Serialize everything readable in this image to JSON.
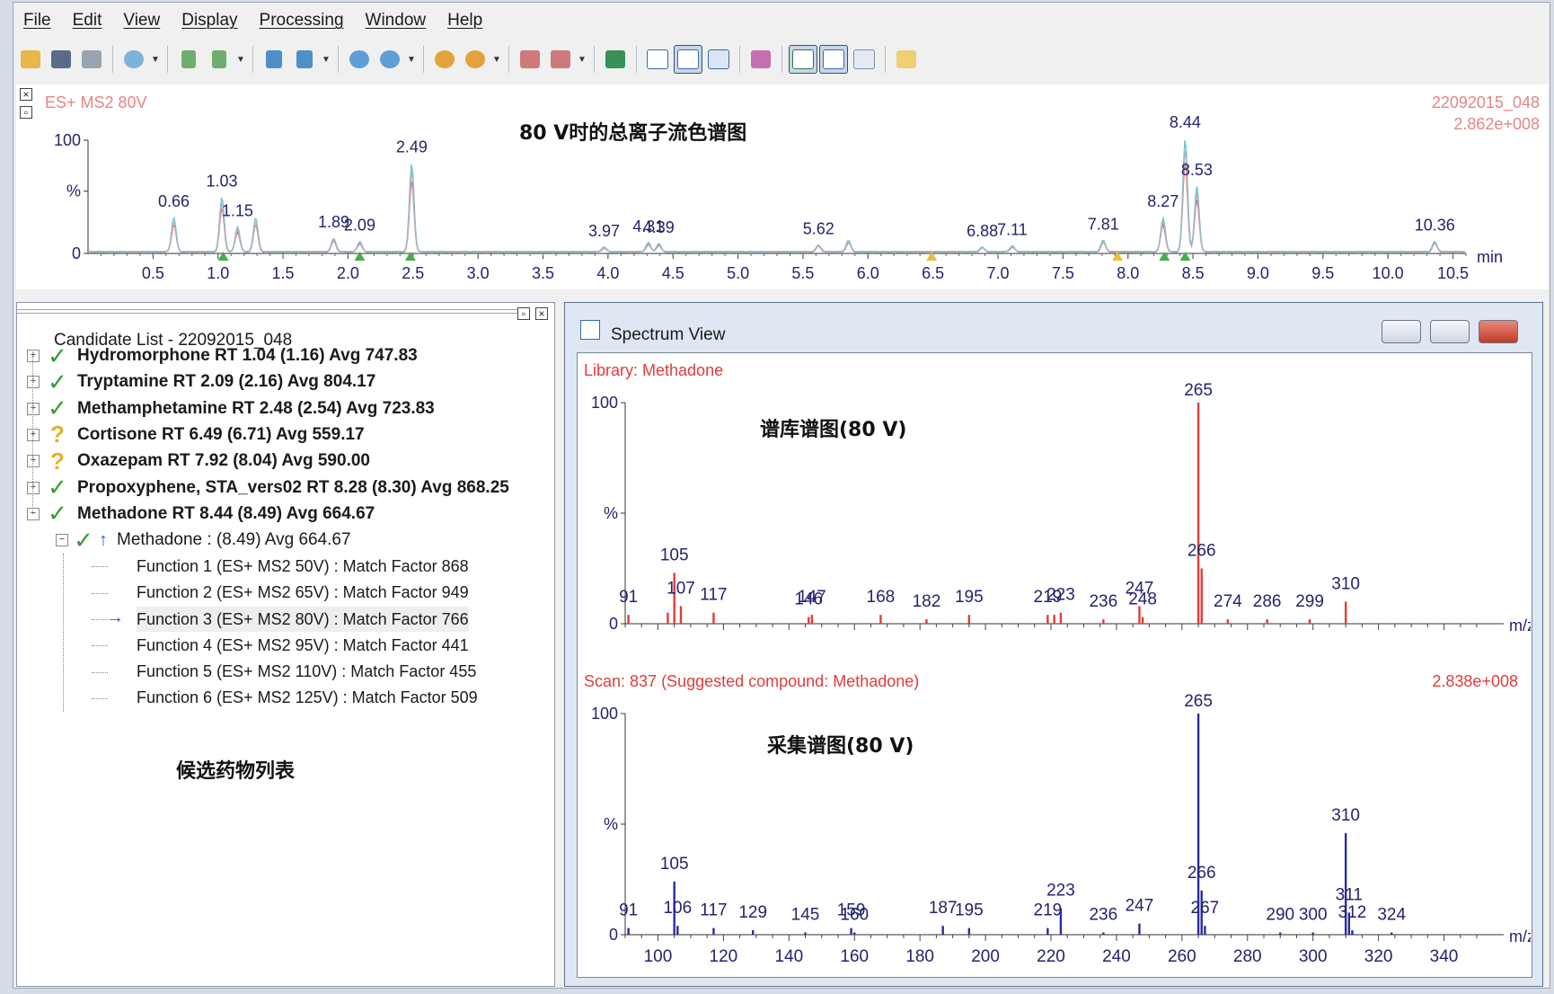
{
  "menu": [
    "File",
    "Edit",
    "View",
    "Display",
    "Processing",
    "Window",
    "Help"
  ],
  "toolbar": {
    "icons": [
      "open-folder-icon",
      "save-icon",
      "print-icon",
      "chromatogram-icon",
      "scan-back-icon",
      "scan-forward-icon",
      "function-back-icon",
      "function-forward-icon",
      "peak-detect-icon",
      "peak-list-icon",
      "locate-icon",
      "locate-forward-icon",
      "library-icon",
      "library-forward-icon",
      "zoom-fit-icon",
      "chromatogram-view-icon",
      "spectrum-view-icon",
      "report-view-icon",
      "map-icon",
      "chrom-toggle-icon",
      "spectrum-toggle-icon",
      "table-view-icon",
      "notes-icon"
    ]
  },
  "annotations": {
    "tic": "80 V时的总离子流色谱图",
    "library": "谱库谱图(80 V)",
    "acquired": "采集谱图(80 V)",
    "candidates": "候选药物列表"
  },
  "candidate_list": {
    "title": "Candidate List - 22092015_048",
    "items": [
      {
        "mark": "✓",
        "status": "match",
        "label": "Hydromorphone RT 1.04 (1.16) Avg 747.83"
      },
      {
        "mark": "✓",
        "status": "match",
        "label": "Tryptamine RT 2.09 (2.16) Avg 804.17"
      },
      {
        "mark": "✓",
        "status": "match",
        "label": "Methamphetamine RT 2.48 (2.54) Avg 723.83"
      },
      {
        "mark": "?",
        "status": "uncertain",
        "label": "Cortisone RT 6.49 (6.71) Avg 559.17"
      },
      {
        "mark": "?",
        "status": "uncertain",
        "label": "Oxazepam RT 7.92 (8.04) Avg 590.00"
      },
      {
        "mark": "✓",
        "status": "match",
        "label": "Propoxyphene, STA_vers02 RT 8.28 (8.30) Avg 868.25"
      },
      {
        "mark": "✓",
        "status": "match",
        "label": "Methadone RT 8.44 (8.49) Avg 664.67"
      }
    ],
    "subitem": {
      "mark": "✓",
      "arrow": "↑",
      "label": "Methadone : (8.49) Avg 664.67"
    },
    "functions": [
      "Function 1 (ES+ MS2  50V) : Match Factor 868",
      "Function 2 (ES+ MS2  65V) : Match Factor 949",
      "Function 3 (ES+ MS2  80V) : Match Factor 766",
      "Function 4 (ES+ MS2  95V) : Match Factor 441",
      "Function 5 (ES+ MS2 110V) : Match Factor 455",
      "Function 6 (ES+ MS2 125V) : Match Factor 509"
    ],
    "current_arrow": "→"
  },
  "spectrum_window": {
    "title": "Spectrum View"
  },
  "colors": {
    "red": "#e23b3b",
    "blue": "#2b2b9e",
    "teal": "#6fc3c8",
    "tic_red": "#e86a6a",
    "check": "#2f9e2f",
    "question": "#e1b12c"
  },
  "chart_data": [
    {
      "type": "line",
      "id": "tic",
      "header_left": "ES+ MS2  80V",
      "header_right": [
        "22092015_048",
        "2.862e+008"
      ],
      "x_unit": "min",
      "y_ticks": [
        "0",
        "%",
        "100"
      ],
      "xlim": [
        0.0,
        10.6
      ],
      "ylim": [
        0,
        100
      ],
      "x_ticks": [
        0.5,
        1.0,
        1.5,
        2.0,
        2.5,
        3.0,
        3.5,
        4.0,
        4.5,
        5.0,
        5.5,
        6.0,
        6.5,
        7.0,
        7.5,
        8.0,
        8.5,
        9.0,
        9.5,
        10.0,
        10.5
      ],
      "x_tick_labels": [
        "0.5",
        "1.0",
        "1.5",
        "2.0",
        "2.5",
        "3.0",
        "3.5",
        "4.0",
        "4.5",
        "5.0",
        "5.5",
        "6.0",
        "6.5",
        "7.0",
        "7.5",
        "8.0",
        "8.5",
        "9.0",
        "9.5",
        "10.0",
        "10.5"
      ],
      "peaks": [
        {
          "rt": 0.66,
          "h": 30,
          "label": "0.66"
        },
        {
          "rt": 1.03,
          "h": 48,
          "label": "1.03"
        },
        {
          "rt": 1.15,
          "h": 22,
          "label": "1.15"
        },
        {
          "rt": 1.29,
          "h": 30,
          "label": ""
        },
        {
          "rt": 1.89,
          "h": 12,
          "label": "1.89"
        },
        {
          "rt": 2.09,
          "h": 9,
          "label": "2.09"
        },
        {
          "rt": 2.49,
          "h": 78,
          "label": "2.49"
        },
        {
          "rt": 3.97,
          "h": 4,
          "label": "3.97"
        },
        {
          "rt": 4.31,
          "h": 8,
          "label": "4.31"
        },
        {
          "rt": 4.39,
          "h": 7,
          "label": "4.39"
        },
        {
          "rt": 5.62,
          "h": 6,
          "label": "5.62"
        },
        {
          "rt": 5.85,
          "h": 10,
          "label": ""
        },
        {
          "rt": 6.88,
          "h": 4,
          "label": "6.88"
        },
        {
          "rt": 7.11,
          "h": 5,
          "label": "7.11"
        },
        {
          "rt": 7.81,
          "h": 10,
          "label": "7.81"
        },
        {
          "rt": 8.27,
          "h": 30,
          "label": "8.27"
        },
        {
          "rt": 8.44,
          "h": 100,
          "label": "8.44"
        },
        {
          "rt": 8.53,
          "h": 58,
          "label": "8.53"
        },
        {
          "rt": 10.36,
          "h": 9,
          "label": "10.36"
        }
      ],
      "markers": [
        {
          "rt": 1.04,
          "color": "green"
        },
        {
          "rt": 2.09,
          "color": "green"
        },
        {
          "rt": 2.48,
          "color": "green"
        },
        {
          "rt": 6.49,
          "color": "yellow"
        },
        {
          "rt": 7.92,
          "color": "yellow"
        },
        {
          "rt": 8.28,
          "color": "green"
        },
        {
          "rt": 8.44,
          "color": "green"
        }
      ]
    },
    {
      "type": "bar",
      "id": "library",
      "header_left": "Library: Methadone",
      "header_right": "",
      "x_unit": "m/z",
      "y_ticks": [
        "0",
        "%",
        "100"
      ],
      "xlim": [
        90,
        350
      ],
      "ylim": [
        0,
        100
      ],
      "x_tick_labels_shown": false,
      "peaks": [
        {
          "mz": 91,
          "i": 4,
          "label": "91"
        },
        {
          "mz": 103,
          "i": 5,
          "label": ""
        },
        {
          "mz": 105,
          "i": 23,
          "label": "105"
        },
        {
          "mz": 107,
          "i": 8,
          "label": "107"
        },
        {
          "mz": 117,
          "i": 5,
          "label": "117"
        },
        {
          "mz": 146,
          "i": 3,
          "label": "146"
        },
        {
          "mz": 147,
          "i": 4,
          "label": "147"
        },
        {
          "mz": 168,
          "i": 4,
          "label": "168"
        },
        {
          "mz": 182,
          "i": 2,
          "label": "182"
        },
        {
          "mz": 195,
          "i": 4,
          "label": "195"
        },
        {
          "mz": 219,
          "i": 4,
          "label": "219"
        },
        {
          "mz": 221,
          "i": 4,
          "label": ""
        },
        {
          "mz": 223,
          "i": 5,
          "label": "223"
        },
        {
          "mz": 236,
          "i": 2,
          "label": "236"
        },
        {
          "mz": 247,
          "i": 8,
          "label": "247"
        },
        {
          "mz": 248,
          "i": 3,
          "label": "248"
        },
        {
          "mz": 265,
          "i": 100,
          "label": "265"
        },
        {
          "mz": 266,
          "i": 25,
          "label": "266"
        },
        {
          "mz": 274,
          "i": 2,
          "label": "274"
        },
        {
          "mz": 286,
          "i": 2,
          "label": "286"
        },
        {
          "mz": 299,
          "i": 2,
          "label": "299"
        },
        {
          "mz": 310,
          "i": 10,
          "label": "310"
        }
      ]
    },
    {
      "type": "bar",
      "id": "scan",
      "header_left": "Scan: 837 (Suggested compound: Methadone)",
      "header_right": "2.838e+008",
      "x_unit": "m/z",
      "y_ticks": [
        "0",
        "%",
        "100"
      ],
      "xlim": [
        90,
        350
      ],
      "ylim": [
        0,
        100
      ],
      "x_ticks": [
        100,
        120,
        140,
        160,
        180,
        200,
        220,
        240,
        260,
        280,
        300,
        320,
        340
      ],
      "x_tick_labels": [
        "100",
        "120",
        "140",
        "160",
        "180",
        "200",
        "220",
        "240",
        "260",
        "280",
        "300",
        "320",
        "340"
      ],
      "peaks": [
        {
          "mz": 91,
          "i": 3,
          "label": "91"
        },
        {
          "mz": 105,
          "i": 24,
          "label": "105"
        },
        {
          "mz": 106,
          "i": 4,
          "label": "106"
        },
        {
          "mz": 117,
          "i": 3,
          "label": "117"
        },
        {
          "mz": 129,
          "i": 2,
          "label": "129"
        },
        {
          "mz": 145,
          "i": 1,
          "label": "145"
        },
        {
          "mz": 159,
          "i": 3,
          "label": "159"
        },
        {
          "mz": 160,
          "i": 1,
          "label": "160"
        },
        {
          "mz": 187,
          "i": 4,
          "label": "187"
        },
        {
          "mz": 195,
          "i": 3,
          "label": "195"
        },
        {
          "mz": 219,
          "i": 3,
          "label": "219"
        },
        {
          "mz": 223,
          "i": 12,
          "label": "223"
        },
        {
          "mz": 236,
          "i": 1,
          "label": "236"
        },
        {
          "mz": 247,
          "i": 5,
          "label": "247"
        },
        {
          "mz": 265,
          "i": 100,
          "label": "265"
        },
        {
          "mz": 266,
          "i": 20,
          "label": "266"
        },
        {
          "mz": 267,
          "i": 4,
          "label": "267"
        },
        {
          "mz": 290,
          "i": 1,
          "label": "290"
        },
        {
          "mz": 300,
          "i": 1,
          "label": "300"
        },
        {
          "mz": 310,
          "i": 46,
          "label": "310"
        },
        {
          "mz": 311,
          "i": 10,
          "label": "311"
        },
        {
          "mz": 312,
          "i": 2,
          "label": "312"
        },
        {
          "mz": 324,
          "i": 1,
          "label": "324"
        }
      ]
    }
  ]
}
